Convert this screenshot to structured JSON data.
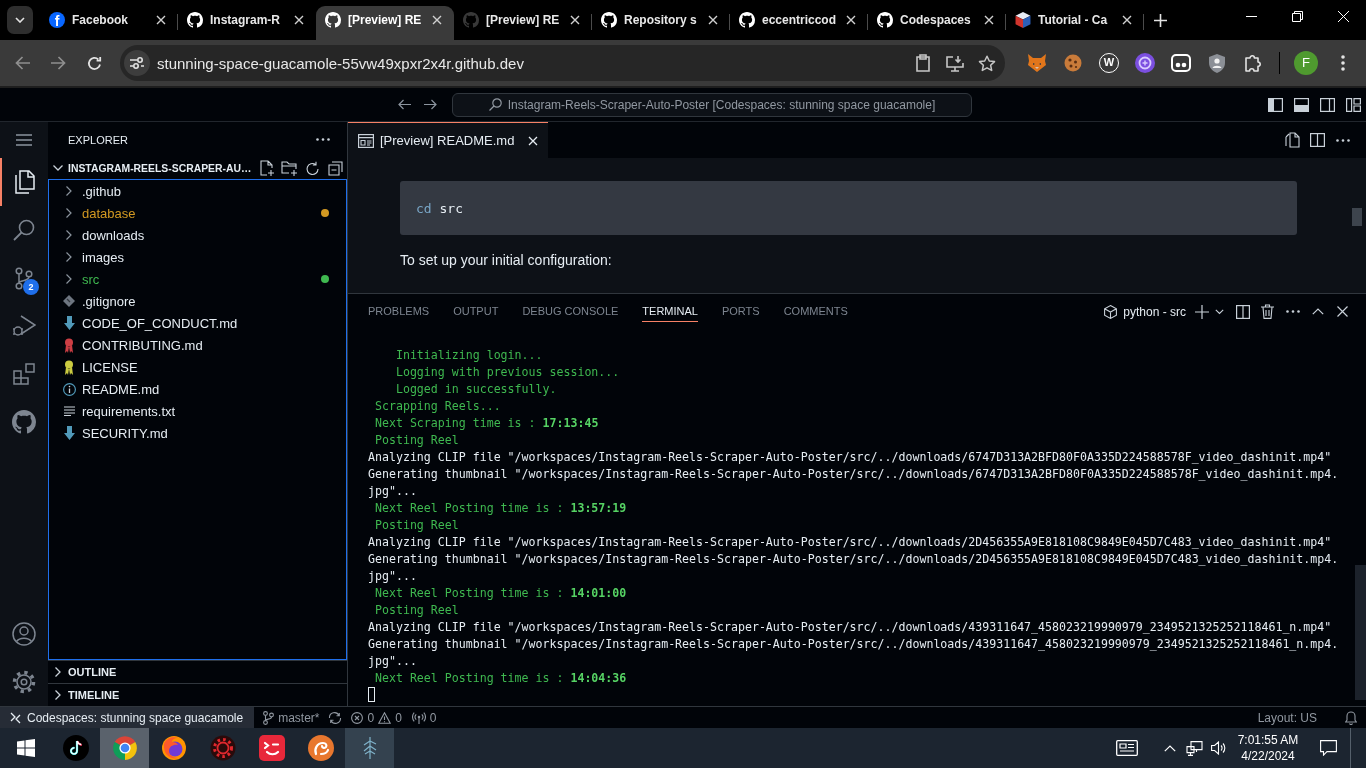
{
  "browser": {
    "tabs": [
      {
        "title": "Facebook",
        "kind": "letter",
        "icon_text": "f",
        "selected": false,
        "dimmed": false
      },
      {
        "title": "Instagram-R",
        "kind": "cat",
        "selected": false,
        "dimmed": false
      },
      {
        "title": "[Preview] RE",
        "kind": "cat",
        "selected": true,
        "dimmed": false
      },
      {
        "title": "[Preview] RE",
        "kind": "cat",
        "selected": false,
        "dimmed": true
      },
      {
        "title": "Repository s",
        "kind": "cat",
        "selected": false,
        "dimmed": false
      },
      {
        "title": "eccentriccod",
        "kind": "cat",
        "selected": false,
        "dimmed": false
      },
      {
        "title": "Codespaces",
        "kind": "cat",
        "selected": false,
        "dimmed": false
      },
      {
        "title": "Tutorial - Ca",
        "kind": "cube",
        "selected": false,
        "dimmed": false
      }
    ],
    "url": "stunning-space-guacamole-55vw49xpxr2x4r.github.dev",
    "extension_letter": "W",
    "profile_initial": "F"
  },
  "vscode": {
    "command_center": "Instagram-Reels-Scraper-Auto-Poster [Codespaces: stunning space guacamole]",
    "activity_bar": [
      {
        "kind": "explorer",
        "selected": true
      },
      {
        "kind": "search",
        "selected": false
      },
      {
        "kind": "source-control",
        "selected": false,
        "badge": "2"
      },
      {
        "kind": "run-debug",
        "selected": false
      },
      {
        "kind": "extensions",
        "selected": false
      },
      {
        "kind": "cat",
        "selected": false
      }
    ],
    "sidebar": {
      "title": "EXPLORER",
      "folder": {
        "name": "INSTAGRAM-REELS-SCRAPER-AU…",
        "expanded": true,
        "focused": true,
        "items": [
          {
            "name": ".github",
            "kind": "folder",
            "expanded": false
          },
          {
            "name": "database",
            "kind": "folder",
            "expanded": false,
            "color": "#d29922"
          },
          {
            "name": "downloads",
            "kind": "folder",
            "expanded": false
          },
          {
            "name": "images",
            "kind": "folder",
            "expanded": false
          },
          {
            "name": "src",
            "kind": "folder",
            "expanded": false,
            "color": "#3fb950"
          },
          {
            "name": ".gitignore",
            "kind": "diamond"
          },
          {
            "name": "CODE_OF_CONDUCT.md",
            "kind": "arrow"
          },
          {
            "name": "CONTRIBUTING.md",
            "kind": "ribbon"
          },
          {
            "name": "LICENSE",
            "kind": "award"
          },
          {
            "name": "README.md",
            "kind": "info"
          },
          {
            "name": "requirements.txt",
            "kind": "lines"
          },
          {
            "name": "SECURITY.md",
            "kind": "arrow"
          }
        ]
      },
      "sections": [
        {
          "title": "OUTLINE",
          "expanded": false
        },
        {
          "title": "TIMELINE",
          "expanded": false
        }
      ]
    },
    "editor": {
      "tabs": [
        {
          "title": "[Preview] README.md",
          "selected": true
        }
      ],
      "preview": [
        {
          "kind": "code",
          "command": "cd",
          "argument": "src"
        },
        {
          "kind": "paragraph",
          "text": "To set up your initial configuration:"
        }
      ]
    },
    "panel": {
      "tabs": [
        {
          "label": "PROBLEMS",
          "selected": false
        },
        {
          "label": "OUTPUT",
          "selected": false
        },
        {
          "label": "DEBUG CONSOLE",
          "selected": false
        },
        {
          "label": "TERMINAL",
          "selected": true
        },
        {
          "label": "PORTS",
          "selected": false
        },
        {
          "label": "COMMENTS",
          "selected": false
        }
      ],
      "terminal_name": "python - src",
      "lines": [
        {
          "kind": "status",
          "text": "    Initializing login..."
        },
        {
          "kind": "status",
          "text": "    Logging with previous session..."
        },
        {
          "kind": "status",
          "text": "    Logged in successfully."
        },
        {
          "kind": "status",
          "text": " Scrapping Reels..."
        },
        {
          "kind": "status",
          "text": " Next Scraping time is : **17:13:45**"
        },
        {
          "kind": "status",
          "text": " Posting Reel"
        },
        {
          "kind": "output",
          "text": "Analyzing CLIP file \"/workspaces/Instagram-Reels-Scraper-Auto-Poster/src/../downloads/6747D313A2BFD80F0A335D224588578F_video_dashinit.mp4\""
        },
        {
          "kind": "output",
          "text": "Generating thumbnail \"/workspaces/Instagram-Reels-Scraper-Auto-Poster/src/../downloads/6747D313A2BFD80F0A335D224588578F_video_dashinit.mp4."
        },
        {
          "kind": "output",
          "text": "jpg\"..."
        },
        {
          "kind": "status",
          "text": " Next Reel Posting time is : **13:57:19**"
        },
        {
          "kind": "status",
          "text": " Posting Reel"
        },
        {
          "kind": "output",
          "text": "Analyzing CLIP file \"/workspaces/Instagram-Reels-Scraper-Auto-Poster/src/../downloads/2D456355A9E818108C9849E045D7C483_video_dashinit.mp4\""
        },
        {
          "kind": "output",
          "text": "Generating thumbnail \"/workspaces/Instagram-Reels-Scraper-Auto-Poster/src/../downloads/2D456355A9E818108C9849E045D7C483_video_dashinit.mp4."
        },
        {
          "kind": "output",
          "text": "jpg\"..."
        },
        {
          "kind": "status",
          "text": " Next Reel Posting time is : **14:01:00**"
        },
        {
          "kind": "status",
          "text": " Posting Reel"
        },
        {
          "kind": "output",
          "text": "Analyzing CLIP file \"/workspaces/Instagram-Reels-Scraper-Auto-Poster/src/../downloads/439311647_458023219990979_2349521325252118461_n.mp4\""
        },
        {
          "kind": "output",
          "text": "Generating thumbnail \"/workspaces/Instagram-Reels-Scraper-Auto-Poster/src/../downloads/439311647_458023219990979_2349521325252118461_n.mp4."
        },
        {
          "kind": "output",
          "text": "jpg\"..."
        },
        {
          "kind": "status",
          "text": " Next Reel Posting time is : **14:04:36**"
        }
      ]
    },
    "status_bar": {
      "remote": "Codespaces: stunning space guacamole",
      "branch": "master*",
      "errors": "0",
      "warnings": "0",
      "ports": "0",
      "layout": "Layout: US"
    }
  },
  "taskbar": {
    "apps": [
      {
        "kind": "note",
        "selected": false,
        "hovered": false
      },
      {
        "kind": "ring",
        "selected": true,
        "hovered": false
      },
      {
        "kind": "globe",
        "selected": false,
        "hovered": false
      },
      {
        "kind": "gear",
        "selected": false,
        "hovered": false
      },
      {
        "kind": "face",
        "selected": false,
        "hovered": false
      },
      {
        "kind": "swirl",
        "selected": false,
        "hovered": false
      },
      {
        "kind": "sketch",
        "selected": false,
        "hovered": true
      }
    ],
    "time": "7:01:55 AM",
    "date": "4/22/2024"
  }
}
